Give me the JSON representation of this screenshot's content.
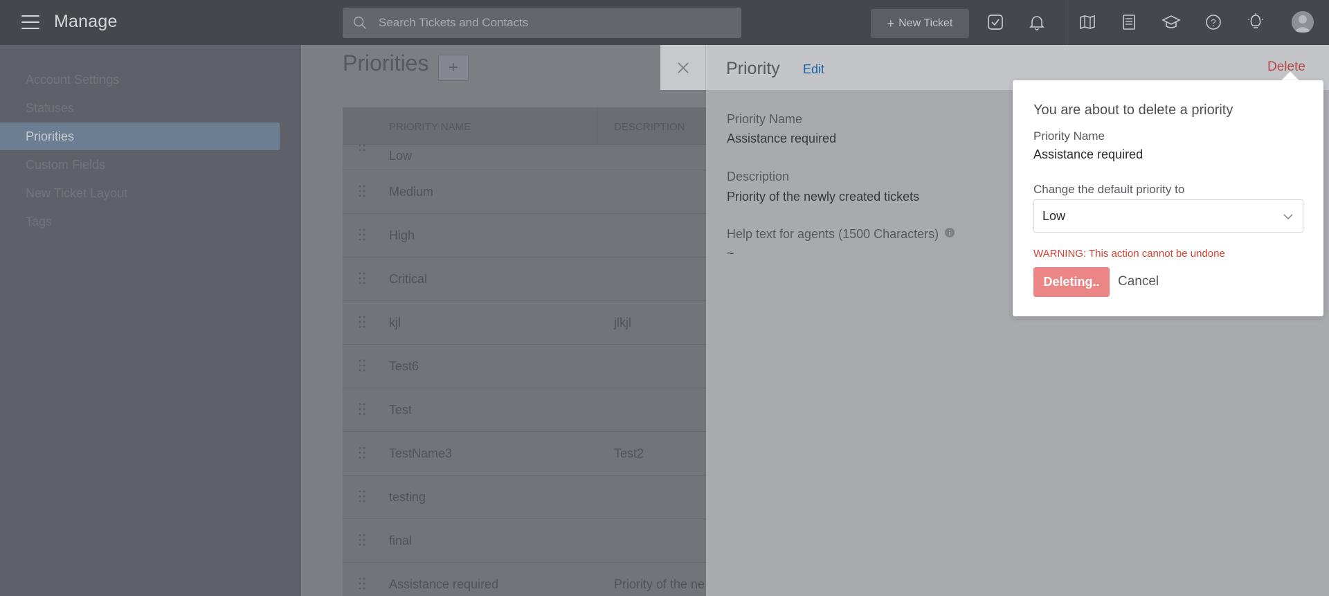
{
  "app": {
    "title": "Manage"
  },
  "header": {
    "search_placeholder": "Search Tickets and Contacts",
    "new_ticket_label": "New Ticket",
    "icons": [
      "check-square-icon",
      "bell-icon",
      "map-icon",
      "newspaper-icon",
      "graduation-cap-icon",
      "help-circle-icon",
      "lightbulb-icon",
      "avatar"
    ]
  },
  "sidebar": {
    "items": [
      {
        "label": "Account Settings",
        "active": false
      },
      {
        "label": "Statuses",
        "active": false
      },
      {
        "label": "Priorities",
        "active": true
      },
      {
        "label": "Custom Fields",
        "active": false
      },
      {
        "label": "New Ticket Layout",
        "active": false
      },
      {
        "label": "Tags",
        "active": false
      }
    ]
  },
  "main": {
    "title": "Priorities",
    "add_label": "+",
    "table": {
      "columns": [
        "PRIORITY NAME",
        "DESCRIPTION"
      ],
      "rows": [
        {
          "name": "Low",
          "description": ""
        },
        {
          "name": "Medium",
          "description": ""
        },
        {
          "name": "High",
          "description": ""
        },
        {
          "name": "Critical",
          "description": ""
        },
        {
          "name": "kjl",
          "description": "jlkjl"
        },
        {
          "name": "Test6",
          "description": ""
        },
        {
          "name": "Test",
          "description": ""
        },
        {
          "name": "TestName3",
          "description": "Test2"
        },
        {
          "name": "testing",
          "description": ""
        },
        {
          "name": "final",
          "description": ""
        },
        {
          "name": "Assistance required",
          "description": "Priority of the ne"
        }
      ]
    }
  },
  "panel": {
    "title": "Priority",
    "edit_label": "Edit",
    "delete_label": "Delete",
    "fields": [
      {
        "label": "Priority Name",
        "value": "Assistance required"
      },
      {
        "label": "Description",
        "value": "Priority of the newly created tickets"
      },
      {
        "label": "Help text for agents (1500 Characters)",
        "value": "~"
      }
    ]
  },
  "delete_popover": {
    "title": "You are about to delete a priority",
    "name_label": "Priority Name",
    "name_value": "Assistance required",
    "change_label": "Change the default priority to",
    "selected_priority": "Low",
    "warning": "WARNING: This action cannot be undone",
    "deleting_label": "Deleting..",
    "cancel_label": "Cancel"
  },
  "colors": {
    "accent_blue": "#1f62a8",
    "delete_red": "#b44a4a",
    "warning_red": "#d8402f",
    "deleting_button": "#ec8585"
  }
}
